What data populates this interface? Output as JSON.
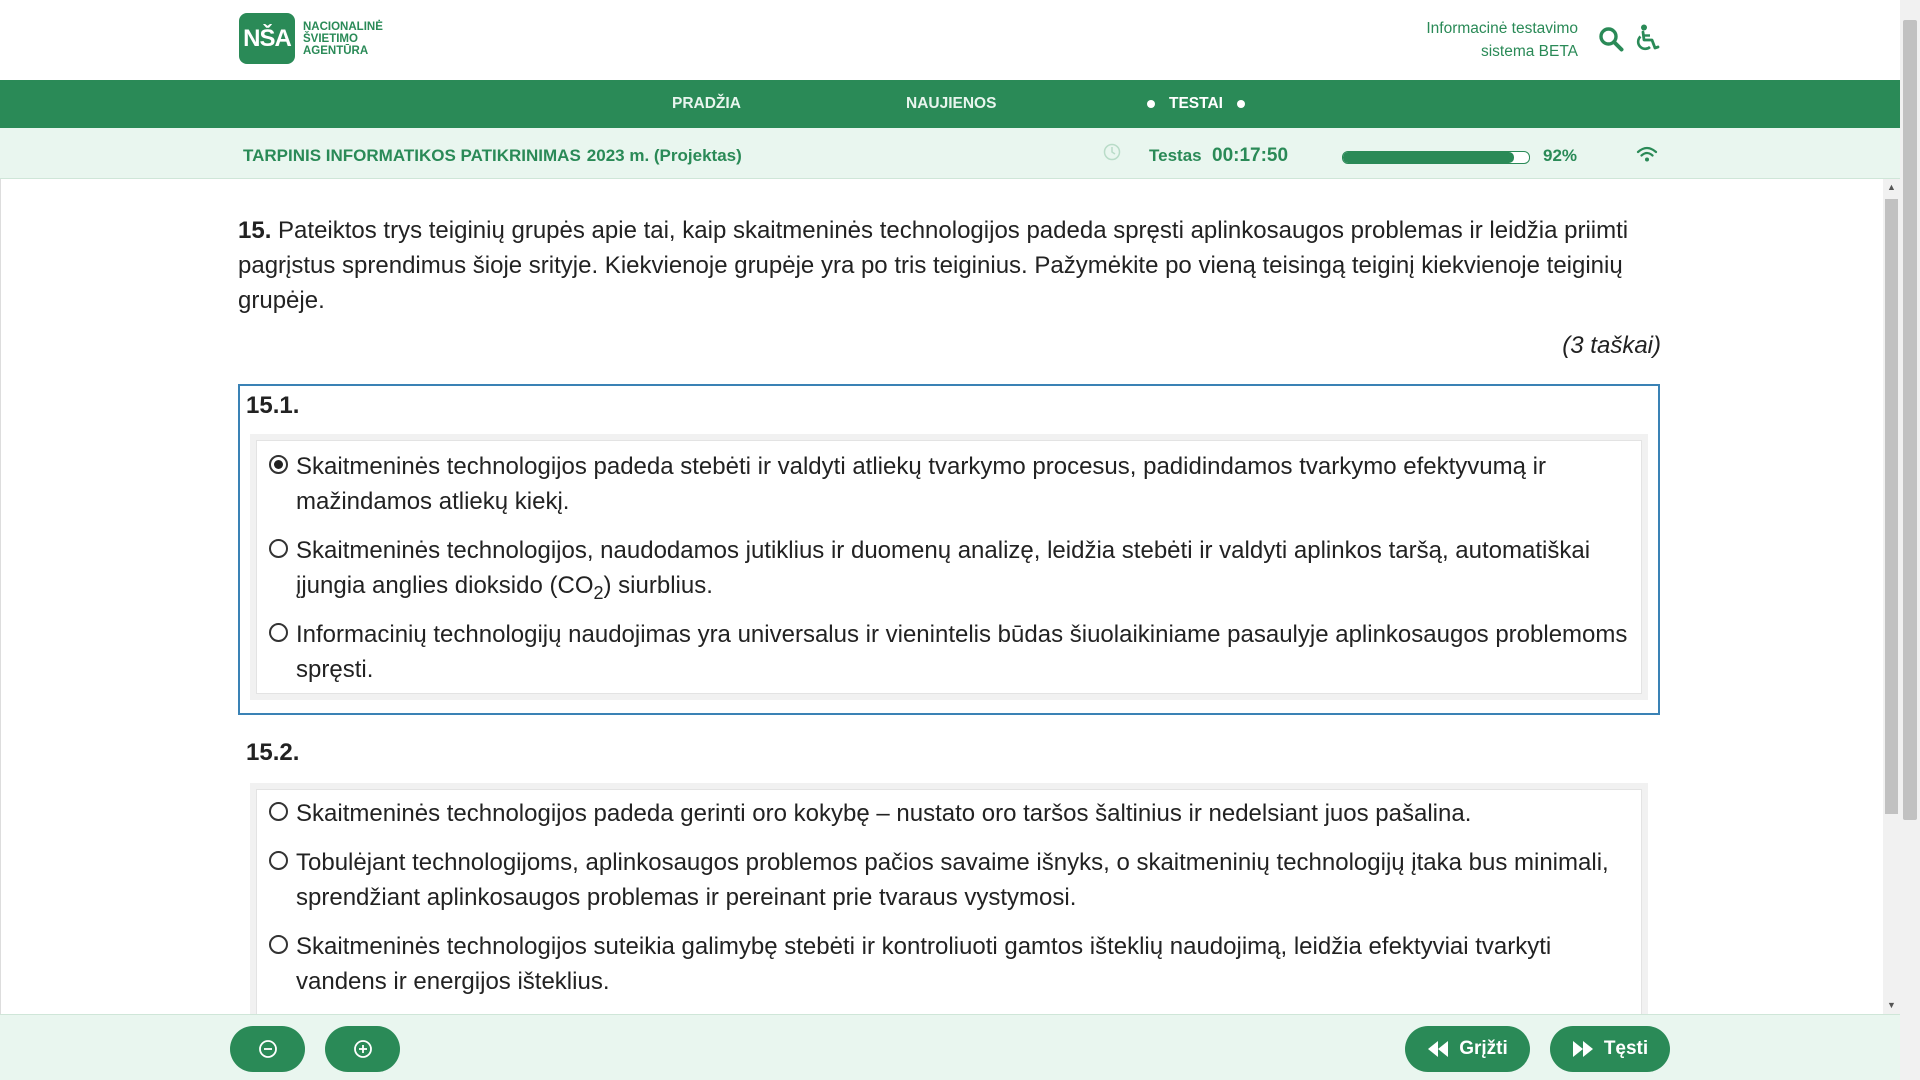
{
  "header": {
    "logo_mark": "NŠA",
    "logo_lines": [
      "NACIONALINĖ",
      "ŠVIETIMO",
      "AGENTŪRA"
    ],
    "system_name_line1": "Informacinė testavimo",
    "system_name_line2": "sistema BETA",
    "search_icon": "search-icon",
    "accessibility_icon": "accessibility-icon"
  },
  "nav": {
    "items": [
      {
        "label": "PRADŽIA",
        "active": false
      },
      {
        "label": "NAUJIENOS",
        "active": false
      },
      {
        "label": "TESTAI",
        "active": true
      }
    ]
  },
  "status": {
    "title": "TARPINIS INFORMATIKOS PATIKRINIMAS",
    "year": "2023 m. (Projektas)",
    "timer_label": "Testas",
    "timer_value": "00:17:50",
    "progress_fraction": 0.92,
    "progress_label": "92%",
    "connection_icon": "wifi-icon",
    "accent_color": "#2a8a57"
  },
  "question": {
    "number": "15.",
    "text": "Pateiktos trys teiginių grupės apie tai, kaip skaitmeninės technologijos padeda spręsti aplinkosaugos problemas ir leidžia priimti pagrįstus sprendimus šioje srityje. Kiekvienoje grupėje yra po tris teiginius. Pažymėkite po vieną teisingą teiginį kiekvienoje teiginių grupėje.",
    "points": "(3 taškai)",
    "groups": [
      {
        "title": "15.1.",
        "options": [
          {
            "text": "Skaitmeninės technologijos padeda stebėti ir valdyti atliekų tvarkymo procesus, padidindamos tvarkymo efektyvumą ir mažindamos atliekų kiekį.",
            "checked": true
          },
          {
            "text_before": "Skaitmeninės technologijos, naudodamos jutiklius ir duomenų analizę, leidžia stebėti ir valdyti aplinkos taršą, automatiškai įjungia anglies dioksido (CO",
            "subscript": "2",
            "text_after": ") siurblius.",
            "checked": false
          },
          {
            "text": "Informacinių technologijų naudojimas yra universalus ir vienintelis būdas šiuolaikiniame pasaulyje aplinkosaugos problemoms spręsti.",
            "checked": false
          }
        ]
      },
      {
        "title": "15.2.",
        "options": [
          {
            "text": "Skaitmeninės technologijos padeda gerinti oro kokybę – nustato oro taršos šaltinius ir nedelsiant juos pašalina.",
            "checked": false
          },
          {
            "text": "Tobulėjant technologijoms, aplinkosaugos problemos pačios savaime išnyks, o skaitmeninių technologijų įtaka bus minimali, sprendžiant aplinkosaugos problemas ir pereinant prie tvaraus vystymosi.",
            "checked": false
          },
          {
            "text": "Skaitmeninės technologijos suteikia galimybę stebėti ir kontroliuoti gamtos išteklių naudojimą, leidžia efektyviai tvarkyti vandens ir energijos išteklius.",
            "checked": false
          }
        ]
      }
    ]
  },
  "footer": {
    "zoom_out_icon": "zoom-out-icon",
    "zoom_in_icon": "zoom-in-icon",
    "back_label": "Grįžti",
    "next_label": "Tęsti"
  }
}
